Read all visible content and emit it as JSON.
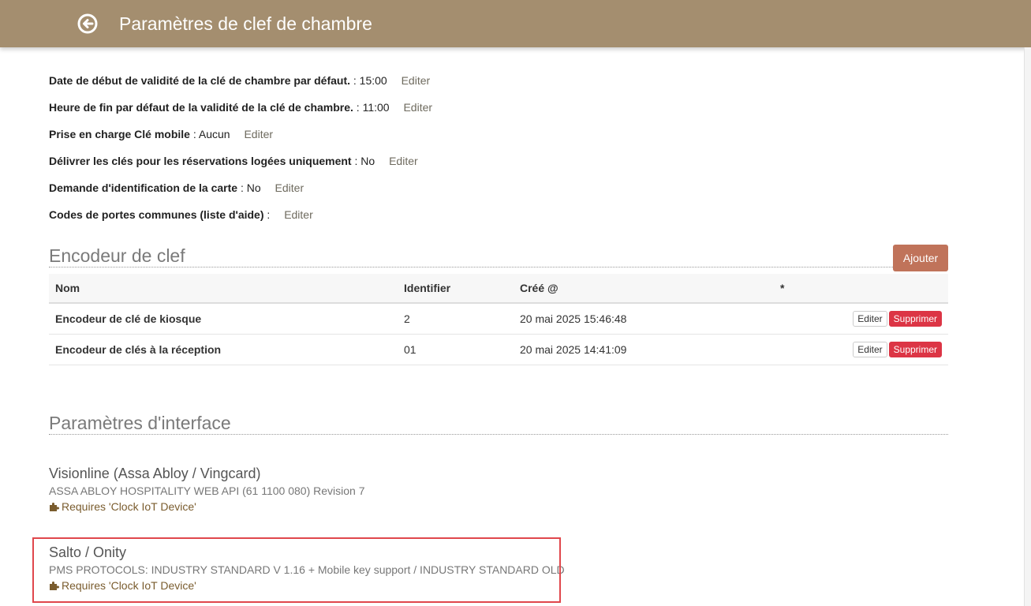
{
  "header": {
    "title": "Paramètres de clef de chambre",
    "back_icon": "back-arrow-circle-icon"
  },
  "settings": [
    {
      "label": "Date de début de validité de la clé de chambre par défaut.",
      "value": " : 15:00",
      "edit": "Editer"
    },
    {
      "label": "Heure de fin par défaut de la validité de la clé de chambre.",
      "value": " : 11:00",
      "edit": "Editer"
    },
    {
      "label": "Prise en charge Clé mobile",
      "value": " : Aucun",
      "edit": "Editer"
    },
    {
      "label": "Délivrer les clés pour les réservations logées uniquement",
      "value": " : No",
      "edit": "Editer"
    },
    {
      "label": "Demande d'identification de la carte",
      "value": " : No",
      "edit": "Editer"
    },
    {
      "label": "Codes de portes communes (liste d'aide)",
      "value": " :",
      "edit": "Editer"
    }
  ],
  "encoders": {
    "heading": "Encodeur de clef",
    "add_label": "Ajouter",
    "columns": {
      "name": "Nom",
      "identifier": "Identifier",
      "created": "Créé @",
      "star": "*"
    },
    "rows": [
      {
        "name": "Encodeur de clé de kiosque",
        "identifier": "2",
        "created": "20 mai 2025 15:46:48",
        "edit": "Editer",
        "delete": "Supprimer"
      },
      {
        "name": "Encodeur de clés à la réception",
        "identifier": "01",
        "created": "20 mai 2025 14:41:09",
        "edit": "Editer",
        "delete": "Supprimer"
      }
    ]
  },
  "interfaces": {
    "heading": "Paramètres d'interface",
    "items": [
      {
        "name": "Visionline (Assa Abloy / Vingcard)",
        "description": "ASSA ABLOY HOSPITALITY WEB API (61 1100 080) Revision 7",
        "requirement": "Requires 'Clock IoT Device'",
        "icon": "puzzle-piece-icon"
      },
      {
        "name": "Salto / Onity",
        "description": "PMS PROTOCOLS: INDUSTRY STANDARD V 1.16 + Mobile key support / INDUSTRY STANDARD OLD",
        "requirement": "Requires 'Clock IoT Device'",
        "icon": "puzzle-piece-icon"
      }
    ]
  },
  "colors": {
    "header_bg": "#a48e6f",
    "accent_button": "#c0735a",
    "delete_button": "#dc3545",
    "highlight_border": "#e0474c"
  }
}
